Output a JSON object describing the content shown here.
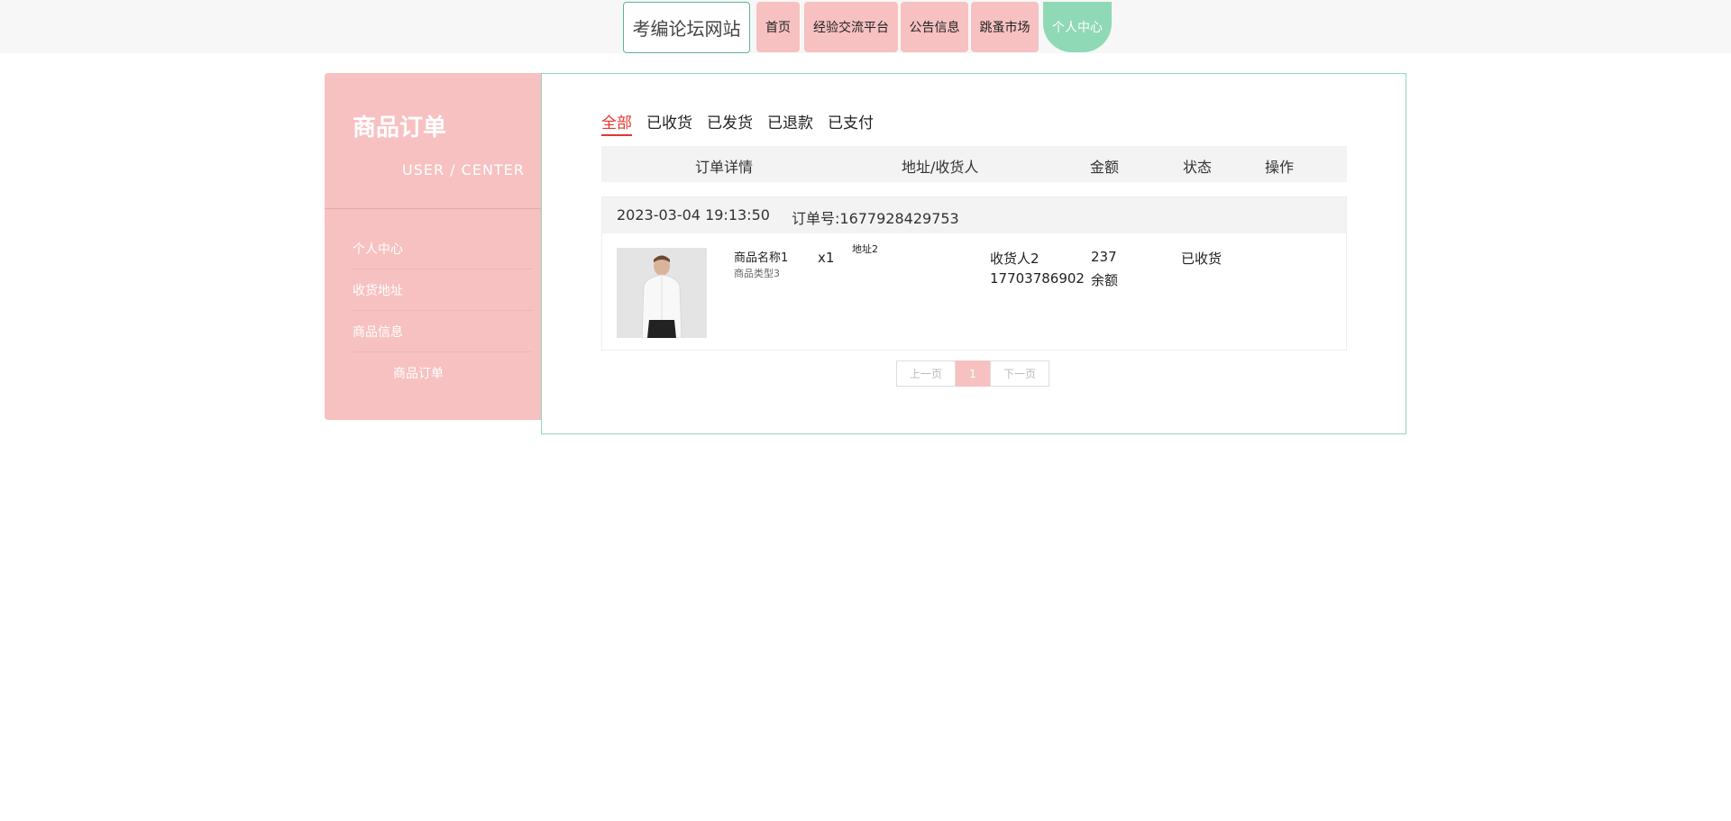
{
  "colors": {
    "pink": "#f7c1c1",
    "mint": "#8fd9b6",
    "active_tab": "#e8342e"
  },
  "nav": {
    "site_title": "考编论坛网站",
    "items": [
      "首页",
      "经验交流平台",
      "公告信息",
      "跳蚤市场",
      "个人中心"
    ],
    "active": "个人中心"
  },
  "sidebar": {
    "title": "商品订单",
    "subtitle": "USER / CENTER",
    "items": [
      "个人中心",
      "收货地址",
      "商品信息",
      "商品订单"
    ]
  },
  "tabs": {
    "items": [
      "全部",
      "已收货",
      "已发货",
      "已退款",
      "已支付"
    ],
    "active": "全部"
  },
  "table": {
    "headers": [
      "订单详情",
      "地址/收货人",
      "金额",
      "状态",
      "操作"
    ]
  },
  "order": {
    "time": "2023-03-04 19:13:50",
    "order_no": "订单号:1677928429753",
    "product_name": "商品名称1",
    "product_type": "商品类型3",
    "quantity": "x1",
    "address": "地址2",
    "receiver": "收货人2",
    "phone": "17703786902",
    "amount": "237",
    "pay_method": "余额",
    "status": "已收货"
  },
  "pager": {
    "prev": "上一页",
    "current": "1",
    "next": "下一页"
  }
}
